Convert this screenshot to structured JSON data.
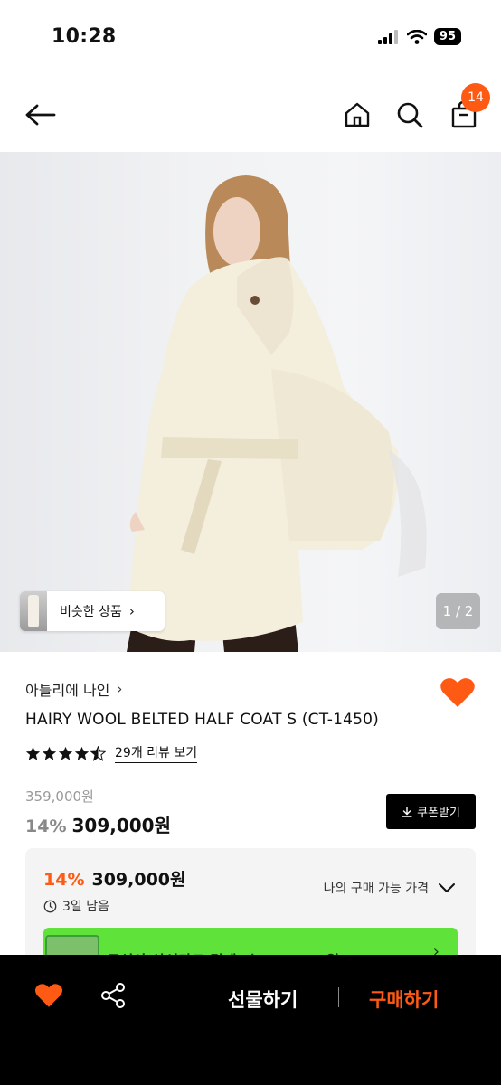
{
  "status_bar": {
    "time": "10:28",
    "battery": "95"
  },
  "header": {
    "cart_count": "14",
    "icons": [
      "back-arrow-icon",
      "home-icon",
      "search-icon",
      "shopping-bag-icon"
    ]
  },
  "gallery": {
    "similar_products_label": "비슷한 상품",
    "page_indicator": "1 / 2"
  },
  "product": {
    "brand": "아틀리에 나인",
    "title": "HAIRY WOOL BELTED HALF COAT S (CT-1450)",
    "rating": 4.5,
    "review_link": "29개 리뷰 보기",
    "original_price": "359,000원",
    "discount": "14%",
    "price": "309,000원",
    "coupon_button": "쿠폰받기"
  },
  "price_card": {
    "discount": "14%",
    "price": "309,000원",
    "remaining": "3일 남음",
    "my_price_label": "나의 구매 가능 가격",
    "promo_text": "무신사 삼성카드 결제 시 274,000원"
  },
  "bottom_bar": {
    "gift_label": "선물하기",
    "buy_label": "구매하기"
  },
  "colors": {
    "accent": "#ff5a14",
    "promo_green": "#5fe33a",
    "bottom_bar": "#000000"
  }
}
